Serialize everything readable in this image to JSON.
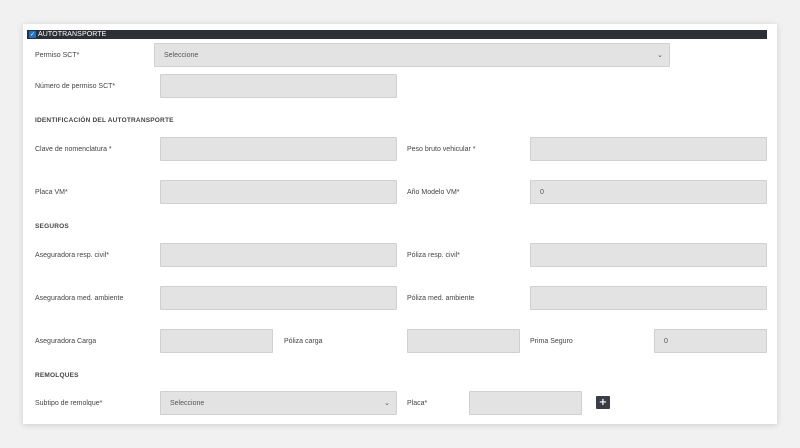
{
  "header": {
    "checkbox_glyph": "✓",
    "title": "AUTOTRANSPORTE"
  },
  "permiso": {
    "label": "Permiso SCT*",
    "value": "Seleccione",
    "chevron": "⌄"
  },
  "numero_permiso": {
    "label": "Número de permiso SCT*",
    "value": ""
  },
  "identificacion": {
    "section_title": "IDENTIFICACIÓN DEL AUTOTRANSPORTE",
    "clave_label": "Clave de nomenclatura *",
    "peso_label": "Peso bruto vehicular *",
    "placa_label": "Placa VM*",
    "anio_label": "Año Modelo VM*",
    "anio_value": "0"
  },
  "seguros": {
    "section_title": "SEGUROS",
    "aseg_civil_label": "Aseguradora resp. civil*",
    "poliza_civil_label": "Póliza resp. civil*",
    "aseg_ambiente_label": "Aseguradora med. ambiente",
    "poliza_ambiente_label": "Póliza med. ambiente",
    "aseg_carga_label": "Aseguradora Carga",
    "poliza_carga_label": "Póliza carga",
    "prima_label": "Prima Seguro",
    "prima_value": "0"
  },
  "remolques": {
    "section_title": "REMOLQUES",
    "subtipo_label": "Subtipo de remolque*",
    "subtipo_value": "Seleccione",
    "chevron": "⌄",
    "placa_label": "Placa*",
    "add_glyph": "+"
  },
  "colors": {
    "header_bg": "#2c2f36",
    "checkbox": "#1f73c6",
    "field_bg": "#e3e3e3"
  }
}
